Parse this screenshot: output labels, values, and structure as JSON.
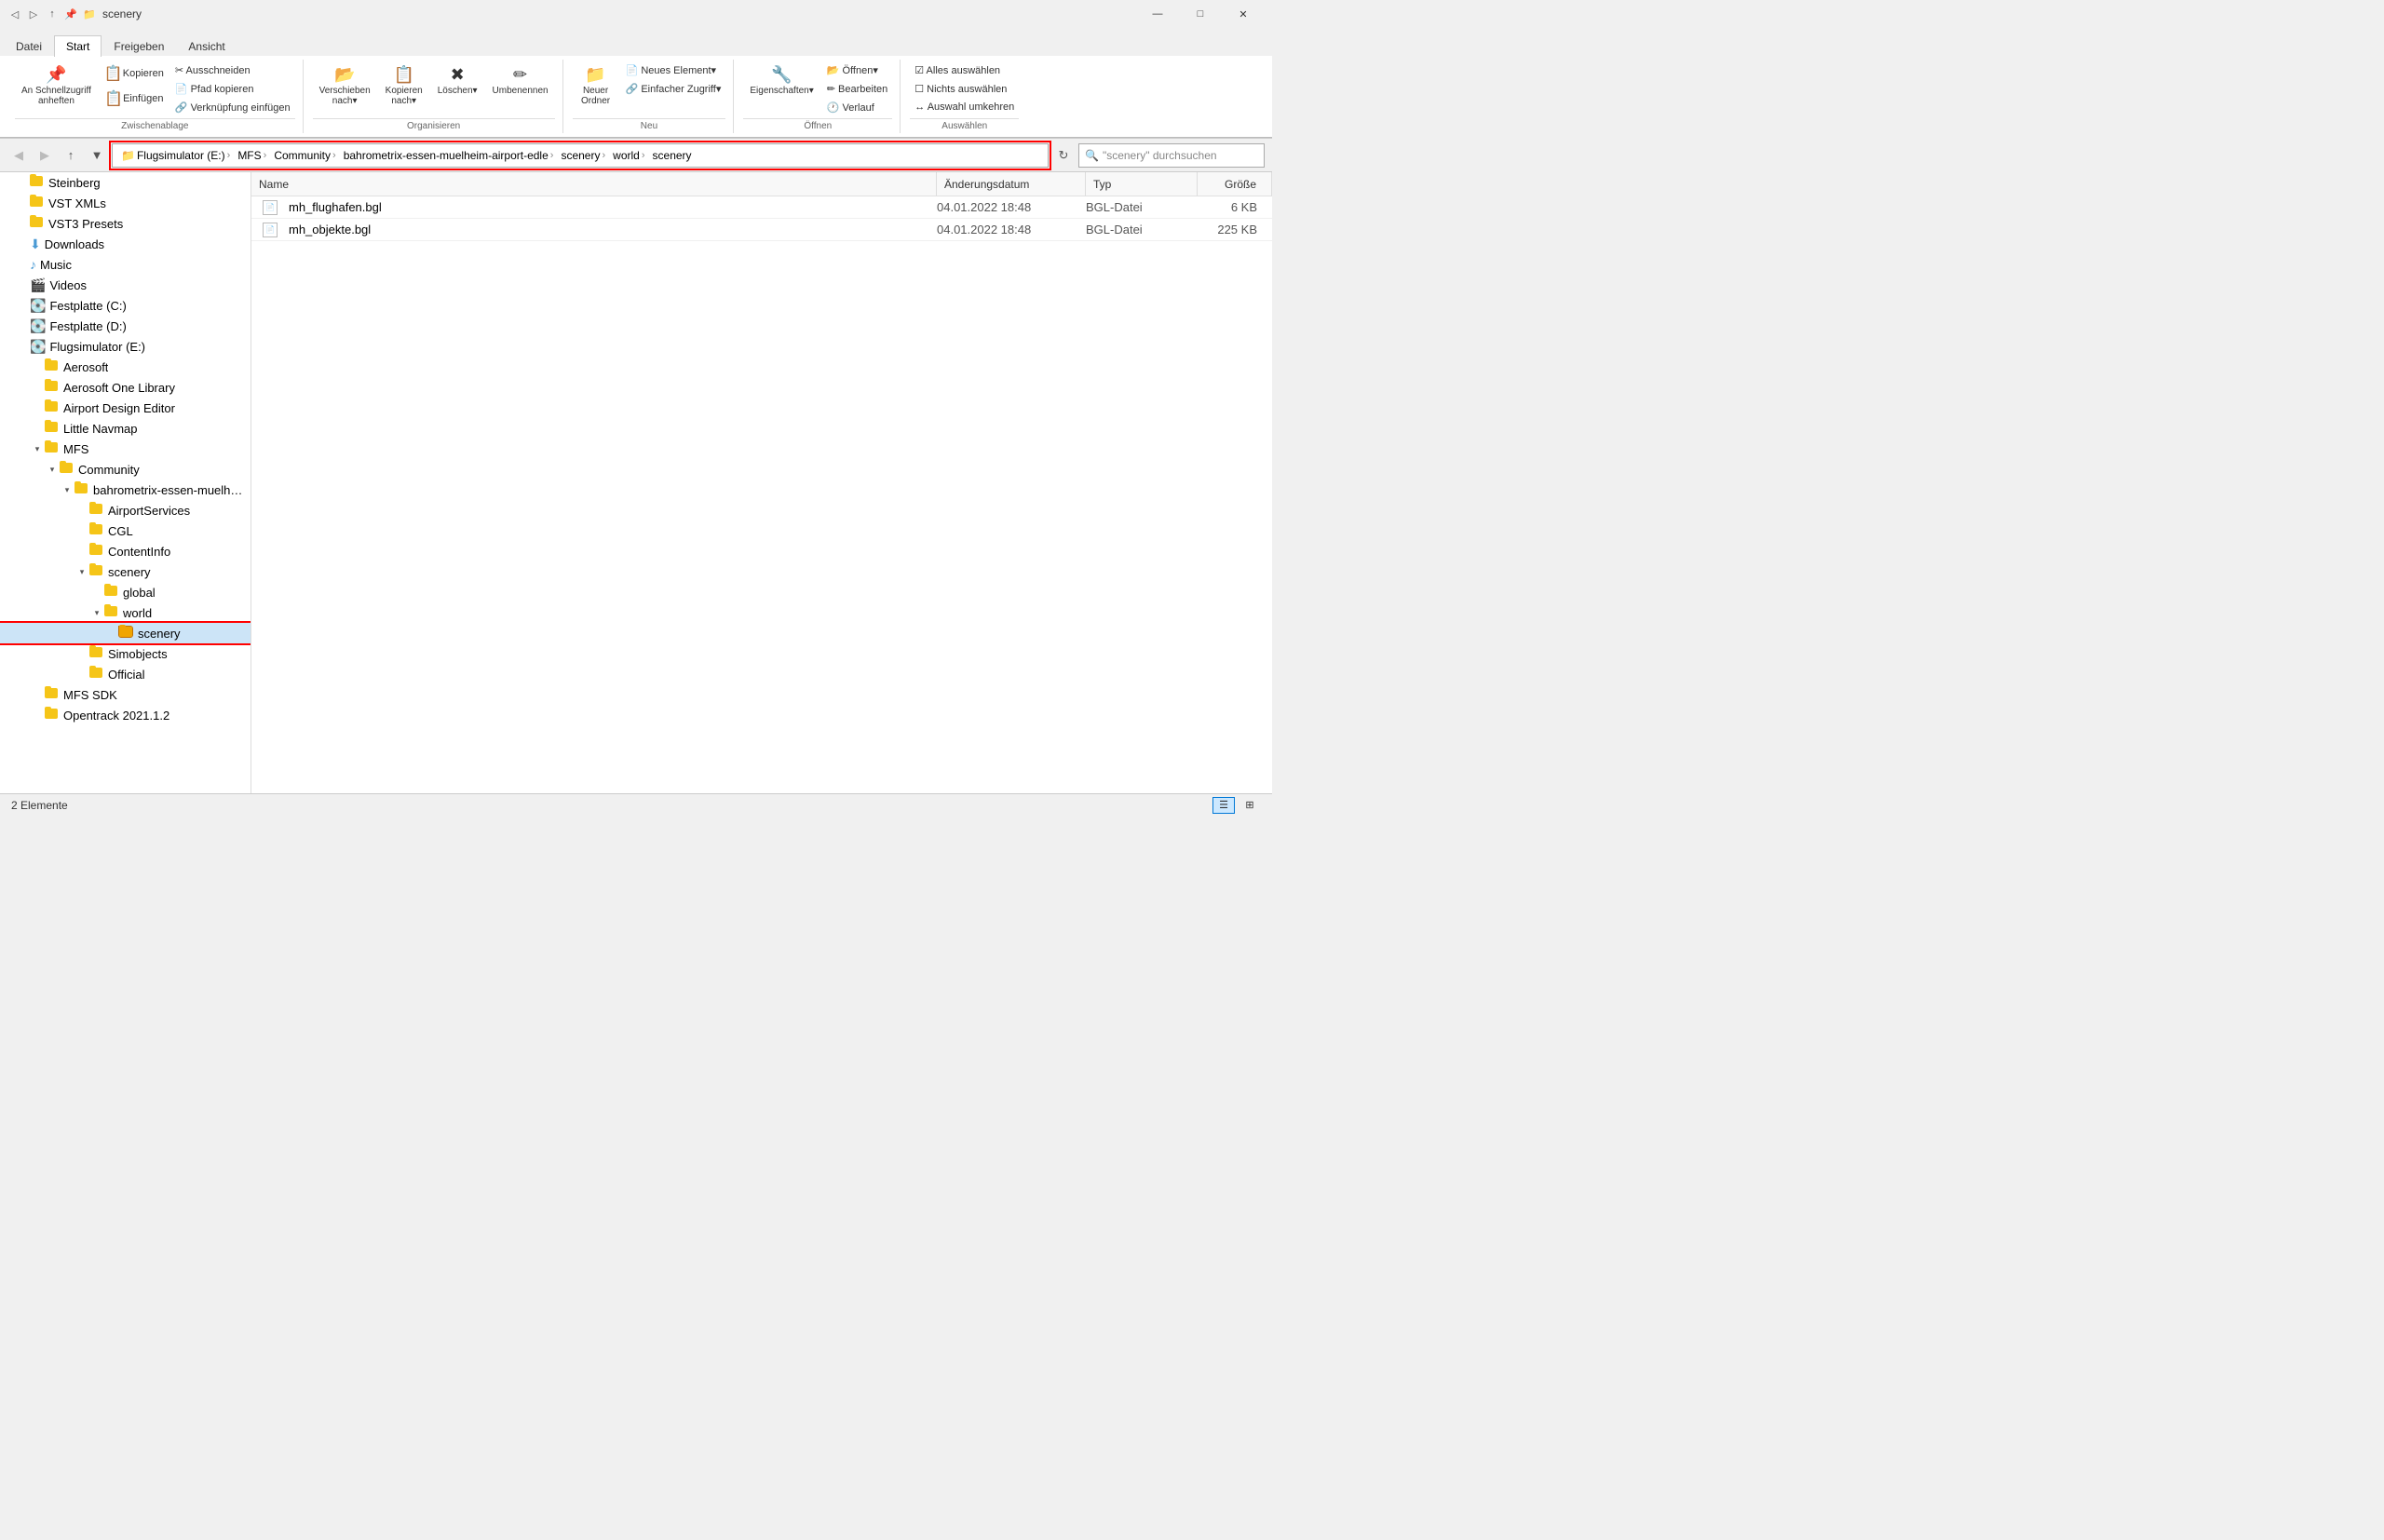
{
  "titleBar": {
    "title": "scenery",
    "quickAccess": [
      "back",
      "forward",
      "up",
      "pin"
    ],
    "controls": [
      "minimize",
      "maximize",
      "close"
    ]
  },
  "ribbon": {
    "tabs": [
      "Datei",
      "Start",
      "Freigeben",
      "Ansicht"
    ],
    "activeTab": "Start",
    "groups": {
      "clipboard": {
        "label": "Zwischenablage",
        "buttons": [
          {
            "id": "pin",
            "icon": "📌",
            "label": "An Schnellzugriff\nanheften"
          },
          {
            "id": "copy",
            "icon": "📋",
            "label": "Kopieren"
          },
          {
            "id": "paste",
            "icon": "📋",
            "label": "Einfügen"
          }
        ],
        "smallButtons": [
          "Ausschneiden",
          "Pfad kopieren",
          "Verknüpfung einfügen"
        ]
      },
      "organize": {
        "label": "Organisieren",
        "buttons": [
          "Verschieben\nnach▾",
          "Kopieren\nnach▾",
          "Löschen▾",
          "Umbenennen"
        ]
      },
      "new": {
        "label": "Neu",
        "buttons": [
          "Neuer\nOrdner"
        ]
      },
      "open": {
        "label": "Öffnen",
        "buttons": [
          "Eigenschaften▾"
        ]
      },
      "select": {
        "label": "Auswählen",
        "buttons": [
          "Alles auswählen",
          "Nichts auswählen",
          "Auswahl umkehren"
        ]
      }
    }
  },
  "addressBar": {
    "segments": [
      {
        "label": "Flugsimulator (E:)",
        "id": "drive"
      },
      {
        "label": "MFS",
        "id": "mfs"
      },
      {
        "label": "Community",
        "id": "community"
      },
      {
        "label": "bahrometrix-essen-muelheim-airport-edle",
        "id": "bahrometrix"
      },
      {
        "label": "scenery",
        "id": "scenery1"
      },
      {
        "label": "world",
        "id": "world"
      },
      {
        "label": "scenery",
        "id": "scenery2"
      }
    ],
    "searchPlaceholder": "\"scenery\" durchsuchen"
  },
  "leftPanel": {
    "items": [
      {
        "id": "steinberg",
        "label": "Steinberg",
        "indent": 1,
        "type": "folder"
      },
      {
        "id": "vstXmls",
        "label": "VST XMLs",
        "indent": 1,
        "type": "folder"
      },
      {
        "id": "vst3presets",
        "label": "VST3 Presets",
        "indent": 1,
        "type": "folder"
      },
      {
        "id": "downloads",
        "label": "Downloads",
        "indent": 1,
        "type": "special"
      },
      {
        "id": "music",
        "label": "Music",
        "indent": 1,
        "type": "music"
      },
      {
        "id": "videos",
        "label": "Videos",
        "indent": 1,
        "type": "video"
      },
      {
        "id": "festplatteC",
        "label": "Festplatte (C:)",
        "indent": 1,
        "type": "drive"
      },
      {
        "id": "festplatteD",
        "label": "Festplatte (D:)",
        "indent": 1,
        "type": "drive"
      },
      {
        "id": "flugsimulatorE",
        "label": "Flugsimulator (E:)",
        "indent": 1,
        "type": "drive"
      },
      {
        "id": "aerosoft",
        "label": "Aerosoft",
        "indent": 2,
        "type": "folder"
      },
      {
        "id": "aerosoftOne",
        "label": "Aerosoft One Library",
        "indent": 2,
        "type": "folder"
      },
      {
        "id": "airportDesign",
        "label": "Airport Design Editor",
        "indent": 2,
        "type": "folder"
      },
      {
        "id": "littleNavmap",
        "label": "Little Navmap",
        "indent": 2,
        "type": "folder"
      },
      {
        "id": "mfs",
        "label": "MFS",
        "indent": 2,
        "type": "folder",
        "expanded": true
      },
      {
        "id": "community",
        "label": "Community",
        "indent": 3,
        "type": "folder",
        "expanded": true
      },
      {
        "id": "bahrometrix",
        "label": "bahrometrix-essen-muelheim-airport-edle",
        "indent": 4,
        "type": "folder",
        "expanded": true
      },
      {
        "id": "airportServices",
        "label": "AirportServices",
        "indent": 5,
        "type": "folder"
      },
      {
        "id": "cgl",
        "label": "CGL",
        "indent": 5,
        "type": "folder"
      },
      {
        "id": "contentInfo",
        "label": "ContentInfo",
        "indent": 5,
        "type": "folder"
      },
      {
        "id": "scenery",
        "label": "scenery",
        "indent": 5,
        "type": "folder",
        "expanded": true
      },
      {
        "id": "global",
        "label": "global",
        "indent": 6,
        "type": "folder"
      },
      {
        "id": "world",
        "label": "world",
        "indent": 6,
        "type": "folder",
        "expanded": true
      },
      {
        "id": "scenerySelected",
        "label": "scenery",
        "indent": 7,
        "type": "folder",
        "selected": true
      },
      {
        "id": "simobjects",
        "label": "Simobjects",
        "indent": 5,
        "type": "folder"
      },
      {
        "id": "official",
        "label": "Official",
        "indent": 5,
        "type": "folder"
      },
      {
        "id": "mfsSdk",
        "label": "MFS SDK",
        "indent": 2,
        "type": "folder"
      },
      {
        "id": "opentrack",
        "label": "Opentrack 2021.1.2",
        "indent": 2,
        "type": "folder"
      }
    ]
  },
  "rightPanel": {
    "columns": [
      {
        "id": "name",
        "label": "Name"
      },
      {
        "id": "date",
        "label": "Änderungsdatum"
      },
      {
        "id": "type",
        "label": "Typ"
      },
      {
        "id": "size",
        "label": "Größe"
      }
    ],
    "files": [
      {
        "id": "mh_flughafen",
        "name": "mh_flughafen.bgl",
        "date": "04.01.2022 18:48",
        "type": "BGL-Datei",
        "size": "6 KB"
      },
      {
        "id": "mh_objekte",
        "name": "mh_objekte.bgl",
        "date": "04.01.2022 18:48",
        "type": "BGL-Datei",
        "size": "225 KB"
      }
    ]
  },
  "statusBar": {
    "itemCount": "2 Elemente",
    "views": [
      "details",
      "large-icons"
    ]
  }
}
